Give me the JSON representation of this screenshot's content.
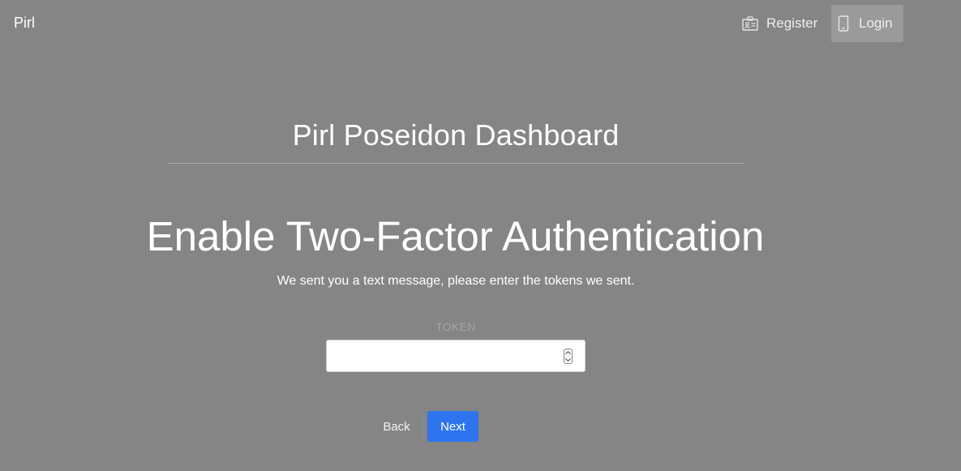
{
  "navbar": {
    "brand": "Pirl",
    "register_label": "Register",
    "register_icon": "id-card-icon",
    "login_label": "Login",
    "login_icon": "mobile-phone-icon"
  },
  "header": {
    "dashboard_title": "Pirl Poseidon Dashboard"
  },
  "main": {
    "heading": "Enable Two-Factor Authentication",
    "subtext": "We sent you a text message, please enter the tokens we sent.",
    "token_label": "TOKEN",
    "token_value": "",
    "back_label": "Back",
    "next_label": "Next"
  },
  "colors": {
    "background": "#858585",
    "primary_button": "#2d74ee",
    "active_nav": "#9a9a9a"
  }
}
